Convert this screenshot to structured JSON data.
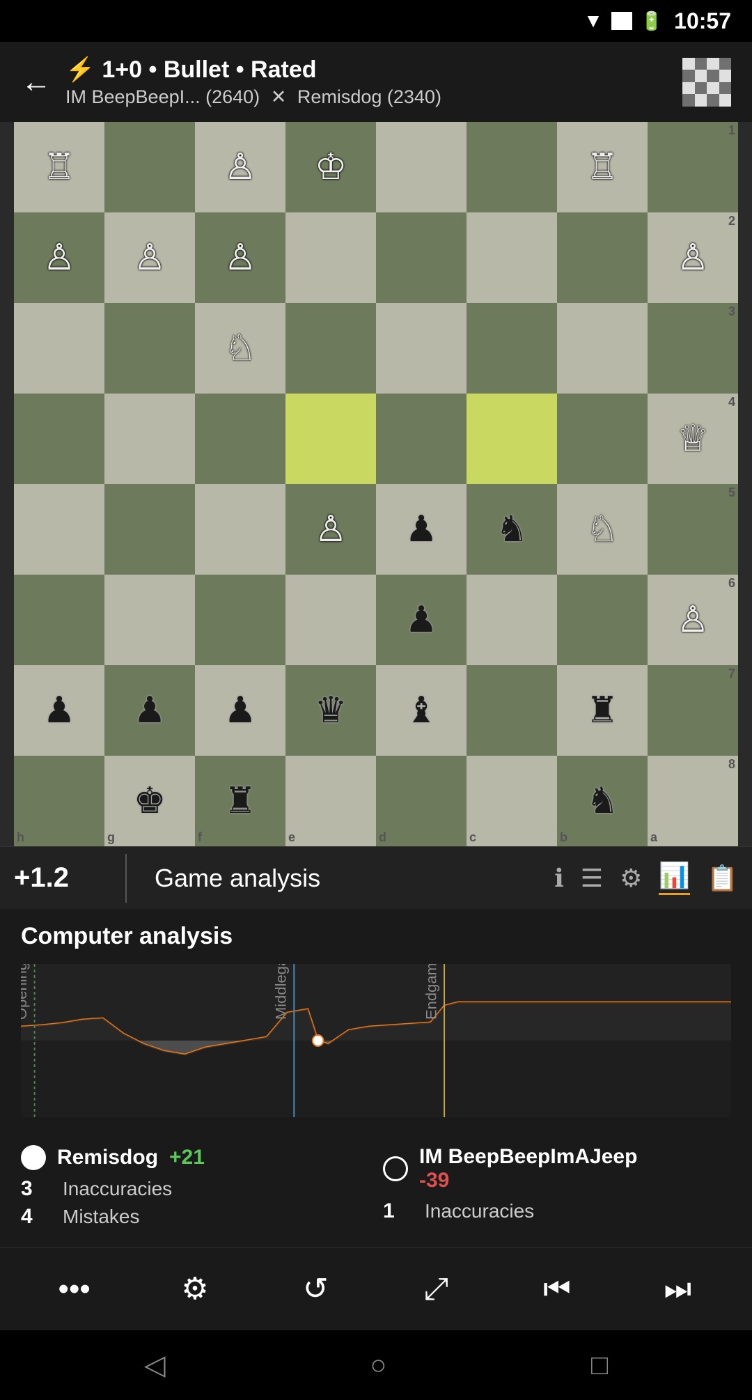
{
  "status_bar": {
    "time": "10:57"
  },
  "header": {
    "back_label": "←",
    "lightning_icon": "⚡",
    "game_type": "1+0 • Bullet • Rated",
    "player1": "IM BeepBeepI... (2640)",
    "player1_symbol": "✕",
    "player2": "Remisdog (2340)"
  },
  "analysis_bar": {
    "score": "+1.2",
    "title": "Game analysis",
    "icons": [
      "ℹ",
      "≡",
      "⚙",
      "📈",
      "📋"
    ]
  },
  "computer_analysis": {
    "title": "Computer analysis"
  },
  "chart": {
    "phases": [
      "Opening",
      "Middlegame",
      "Endgame"
    ]
  },
  "player_stats": {
    "player_white": {
      "name": "Remisdog",
      "score": "+21",
      "stats": [
        {
          "number": "3",
          "label": "Inaccuracies"
        },
        {
          "number": "4",
          "label": "Mistakes"
        }
      ]
    },
    "player_black": {
      "name": "IM BeepBeepImAJeep",
      "score": "-39",
      "stats": [
        {
          "number": "1",
          "label": "Inaccuracies"
        }
      ]
    }
  },
  "toolbar": {
    "buttons": [
      "•••",
      "⚙",
      "↺",
      "⤢",
      "⏮",
      "⏭"
    ]
  },
  "nav_bar": {
    "back": "◁",
    "home": "○",
    "recent": "□"
  },
  "board": {
    "ranks": [
      "1",
      "2",
      "3",
      "4",
      "5",
      "6",
      "7",
      "8"
    ],
    "files": [
      "h",
      "g",
      "f",
      "e",
      "d",
      "c",
      "b",
      "a"
    ]
  }
}
